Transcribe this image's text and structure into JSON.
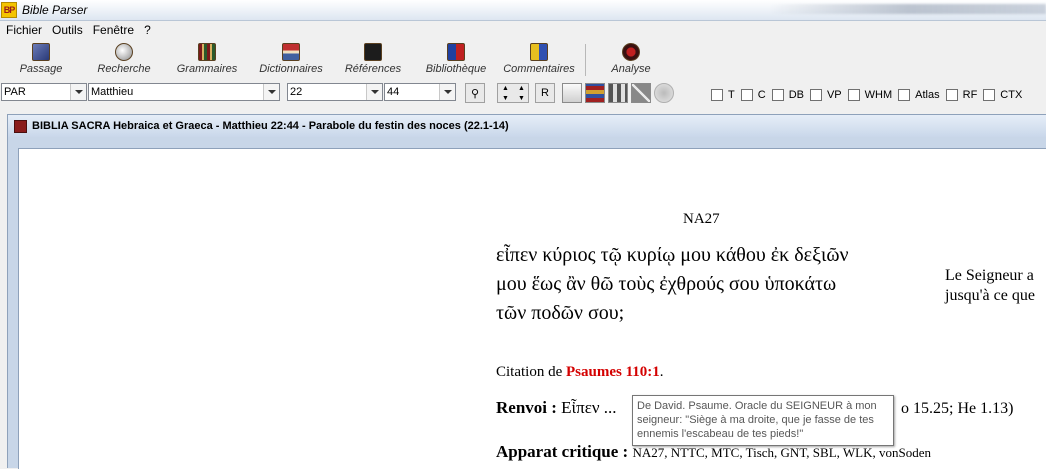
{
  "app": {
    "title": "Bible Parser",
    "logo_text": "BP"
  },
  "menu": {
    "items": [
      "Fichier",
      "Outils",
      "Fenêtre",
      "?"
    ]
  },
  "toolbar": {
    "buttons": [
      {
        "label": "Passage",
        "icon": "passage-icon"
      },
      {
        "label": "Recherche",
        "icon": "search-icon"
      },
      {
        "label": "Grammaires",
        "icon": "grammar-books-icon"
      },
      {
        "label": "Dictionnaires",
        "icon": "dictionary-icon"
      },
      {
        "label": "Références",
        "icon": "references-icon"
      },
      {
        "label": "Bibliothèque",
        "icon": "library-icon"
      },
      {
        "label": "Commentaires",
        "icon": "comments-icon"
      },
      {
        "label": "Analyse",
        "icon": "analysis-icon"
      }
    ]
  },
  "navbar": {
    "version": "PAR",
    "book": "Matthieu",
    "chapter": "22",
    "verse": "44",
    "r_button": "R",
    "checkboxes": [
      "T",
      "C",
      "DB",
      "VP",
      "WHM",
      "Atlas",
      "RF",
      "CTX"
    ]
  },
  "document": {
    "title": "BIBLIA SACRA Hebraica et Graeca - Matthieu 22:44 - Parabole du festin des noces (22.1-14)",
    "version_label": "NA27",
    "greek_lines": [
      "εἶπεν κύριος τῷ κυρίῳ μου κάθου ἐκ δεξιῶν",
      "μου ἕως ἂν θῶ τοὺς ἐχθρούς σου ὑποκάτω",
      "τῶν ποδῶν σου;"
    ],
    "french_lines": [
      "Le Seigneur a",
      "jusqu'à ce que"
    ],
    "citation_prefix": "Citation de",
    "citation_ref": "Psaumes 110:1",
    "citation_suffix": ".",
    "renvoi_label": "Renvoi :",
    "renvoi_text": "Εἶπεν ...",
    "renvoi_refs": "o 15.25; He 1.13)",
    "apparat_label": "Apparat critique :",
    "apparat_list": "NA27, NTTC, MTC, Tisch, GNT, SBL, WLK, vonSoden"
  },
  "tooltip": {
    "lines": [
      "De David. Psaume. Oracle du SEIGNEUR à mon",
      "seigneur: \"Siège à ma droite, que je fasse de tes",
      "ennemis l'escabeau de tes pieds!\""
    ]
  }
}
